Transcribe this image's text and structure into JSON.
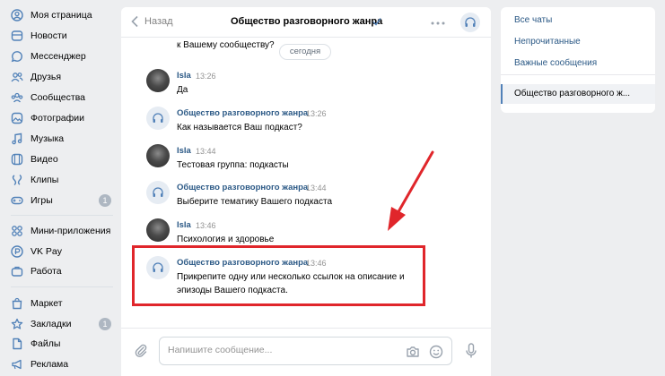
{
  "leftnav": {
    "items": [
      {
        "label": "Моя страница",
        "icon": "user-circle-icon"
      },
      {
        "label": "Новости",
        "icon": "news-icon"
      },
      {
        "label": "Мессенджер",
        "icon": "chat-bubble-icon"
      },
      {
        "label": "Друзья",
        "icon": "friends-icon"
      },
      {
        "label": "Сообщества",
        "icon": "communities-icon"
      },
      {
        "label": "Фотографии",
        "icon": "photo-icon"
      },
      {
        "label": "Музыка",
        "icon": "music-note-icon"
      },
      {
        "label": "Видео",
        "icon": "video-icon"
      },
      {
        "label": "Клипы",
        "icon": "clips-icon"
      },
      {
        "label": "Игры",
        "icon": "gamepad-icon",
        "badge": "1"
      },
      {
        "label": "Мини-приложения",
        "icon": "mini-apps-icon"
      },
      {
        "label": "VK Pay",
        "icon": "vkpay-icon"
      },
      {
        "label": "Работа",
        "icon": "briefcase-icon"
      },
      {
        "label": "Маркет",
        "icon": "shopping-bag-icon"
      },
      {
        "label": "Закладки",
        "icon": "star-icon",
        "badge": "1"
      },
      {
        "label": "Файлы",
        "icon": "file-icon"
      },
      {
        "label": "Реклама",
        "icon": "megaphone-icon"
      }
    ]
  },
  "header": {
    "back_label": "Назад",
    "title": "Общество разговорного жанра"
  },
  "messages": {
    "top_cut_text": "к Вашему сообществу?",
    "date_label": "сегодня",
    "items": [
      {
        "author": "Isla",
        "time": "13:26",
        "text": "Да",
        "kind": "user"
      },
      {
        "author": "Общество разговорного жанра",
        "time": "13:26",
        "text": "Как называется Ваш подкаст?",
        "kind": "group"
      },
      {
        "author": "Isla",
        "time": "13:44",
        "text": "Тестовая группа: подкасты",
        "kind": "user"
      },
      {
        "author": "Общество разговорного жанра",
        "time": "13:44",
        "text": "Выберите тематику Вашего подкаста",
        "kind": "group"
      },
      {
        "author": "Isla",
        "time": "13:46",
        "text": "Психология и здоровье",
        "kind": "user"
      },
      {
        "author": "Общество разговорного жанра",
        "time": "13:46",
        "text": "Прикрепите одну или несколько ссылок на описание и эпизоды Вашего подкаста.",
        "kind": "group"
      }
    ]
  },
  "composer": {
    "placeholder": "Напишите сообщение..."
  },
  "rightpanel": {
    "items": [
      "Все чаты",
      "Непрочитанные",
      "Важные сообщения"
    ],
    "active": "Общество разговорного ж..."
  },
  "colors": {
    "link": "#2a5885",
    "highlight": "#e0262b",
    "badge": "#aeb7c2"
  }
}
